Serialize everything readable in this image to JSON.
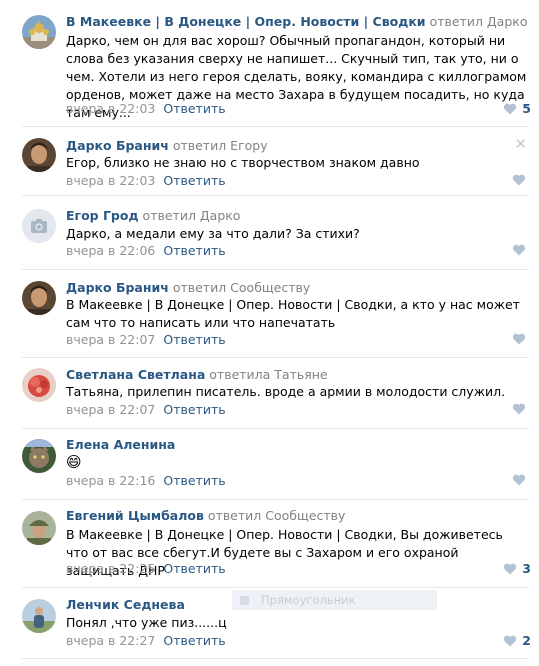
{
  "comments": [
    {
      "author": "В Макеевке | В Донецке | Опер. Новости | Сводки",
      "reply_to": "ответил Дарко",
      "text": "Дарко, чем он для вас хорош? Обычный пропагандон, который ни слова без указания сверху не напишет... Скучный тип, так уто, ни о чем. Хотели из него героя сделать, вояку, командира с киллограмом орденов, может даже на место Захара в будущем посадить, но куда там ему...",
      "date": "вчера в 22:03",
      "answer": "Ответить",
      "likes": "5",
      "avatar_icon": "church-domes-avatar"
    },
    {
      "author": "Дарко Бранич",
      "reply_to": "ответил Егору",
      "text": "Егор, близко не знаю но с творчеством знаком давно",
      "date": "вчера в 22:03",
      "answer": "Ответить",
      "likes": "",
      "avatar_icon": "man-portrait-avatar"
    },
    {
      "author": "Егор Грод",
      "reply_to": "ответил Дарко",
      "text": "Дарко, а медали ему за что дали? За стихи?",
      "date": "вчера в 22:06",
      "answer": "Ответить",
      "likes": "",
      "avatar_icon": "camera-placeholder-icon"
    },
    {
      "author": "Дарко Бранич",
      "reply_to": "ответил Сообществу",
      "text": "В Макеевке | В Донецке | Опер. Новости | Сводки, а кто у нас может сам что то написать или что напечатать",
      "date": "вчера в 22:07",
      "answer": "Ответить",
      "likes": "",
      "avatar_icon": "man-portrait-avatar"
    },
    {
      "author": "Светлана Светлана",
      "reply_to": "ответила Татьяне",
      "text": "Татьяна, прилепин писатель. вроде а армии в молодости служил.",
      "date": "вчера в 22:07",
      "answer": "Ответить",
      "likes": "",
      "avatar_icon": "red-flower-avatar"
    },
    {
      "author": "Елена Аленина",
      "reply_to": "",
      "text": "😄",
      "date": "вчера в 22:16",
      "answer": "Ответить",
      "likes": "",
      "avatar_icon": "cat-avatar"
    },
    {
      "author": "Евгений Цымбалов",
      "reply_to": "ответил Сообществу",
      "text": "В Макеевке | В Донецке | Опер. Новости | Сводки, Вы доживетесь что от вас все сбегут.И будете вы с Захаром и его охраной защищать ДНР",
      "date": "вчера в 22:25",
      "answer": "Ответить",
      "likes": "3",
      "avatar_icon": "soldier-avatar"
    },
    {
      "author": "Ленчик Седнева",
      "reply_to": "",
      "text": "Понял ,что уже пиз......ц",
      "date": "вчера в 22:27",
      "answer": "Ответить",
      "likes": "2",
      "avatar_icon": "person-outdoors-avatar"
    }
  ],
  "overlay_label": "Прямоугольник",
  "colors": {
    "link": "#2a5885",
    "muted": "#939393",
    "divider": "#e7e8ec"
  }
}
